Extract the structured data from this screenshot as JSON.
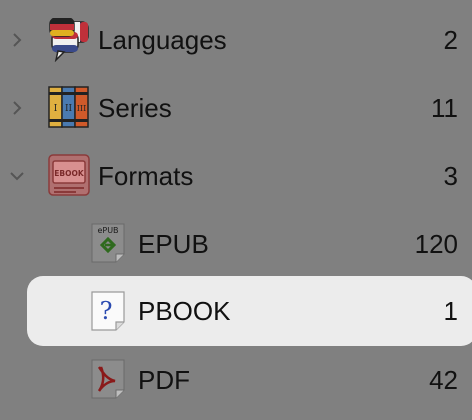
{
  "tree": {
    "items": [
      {
        "label": "Languages",
        "count": "2",
        "icon": "languages-flags-icon",
        "expanded": false
      },
      {
        "label": "Series",
        "count": "11",
        "icon": "series-books-icon",
        "expanded": false
      },
      {
        "label": "Formats",
        "count": "3",
        "icon": "ebook-format-icon",
        "expanded": true
      },
      {
        "label": "EPUB",
        "count": "120",
        "icon": "epub-file-icon",
        "child": true
      },
      {
        "label": "PBOOK",
        "count": "1",
        "icon": "unknown-file-icon",
        "child": true,
        "selected": true
      },
      {
        "label": "PDF",
        "count": "42",
        "icon": "pdf-file-icon",
        "child": true
      }
    ]
  },
  "colors": {
    "background": "#808080",
    "selection": "#ececec",
    "text": "#111111",
    "chevron": "#555555"
  }
}
